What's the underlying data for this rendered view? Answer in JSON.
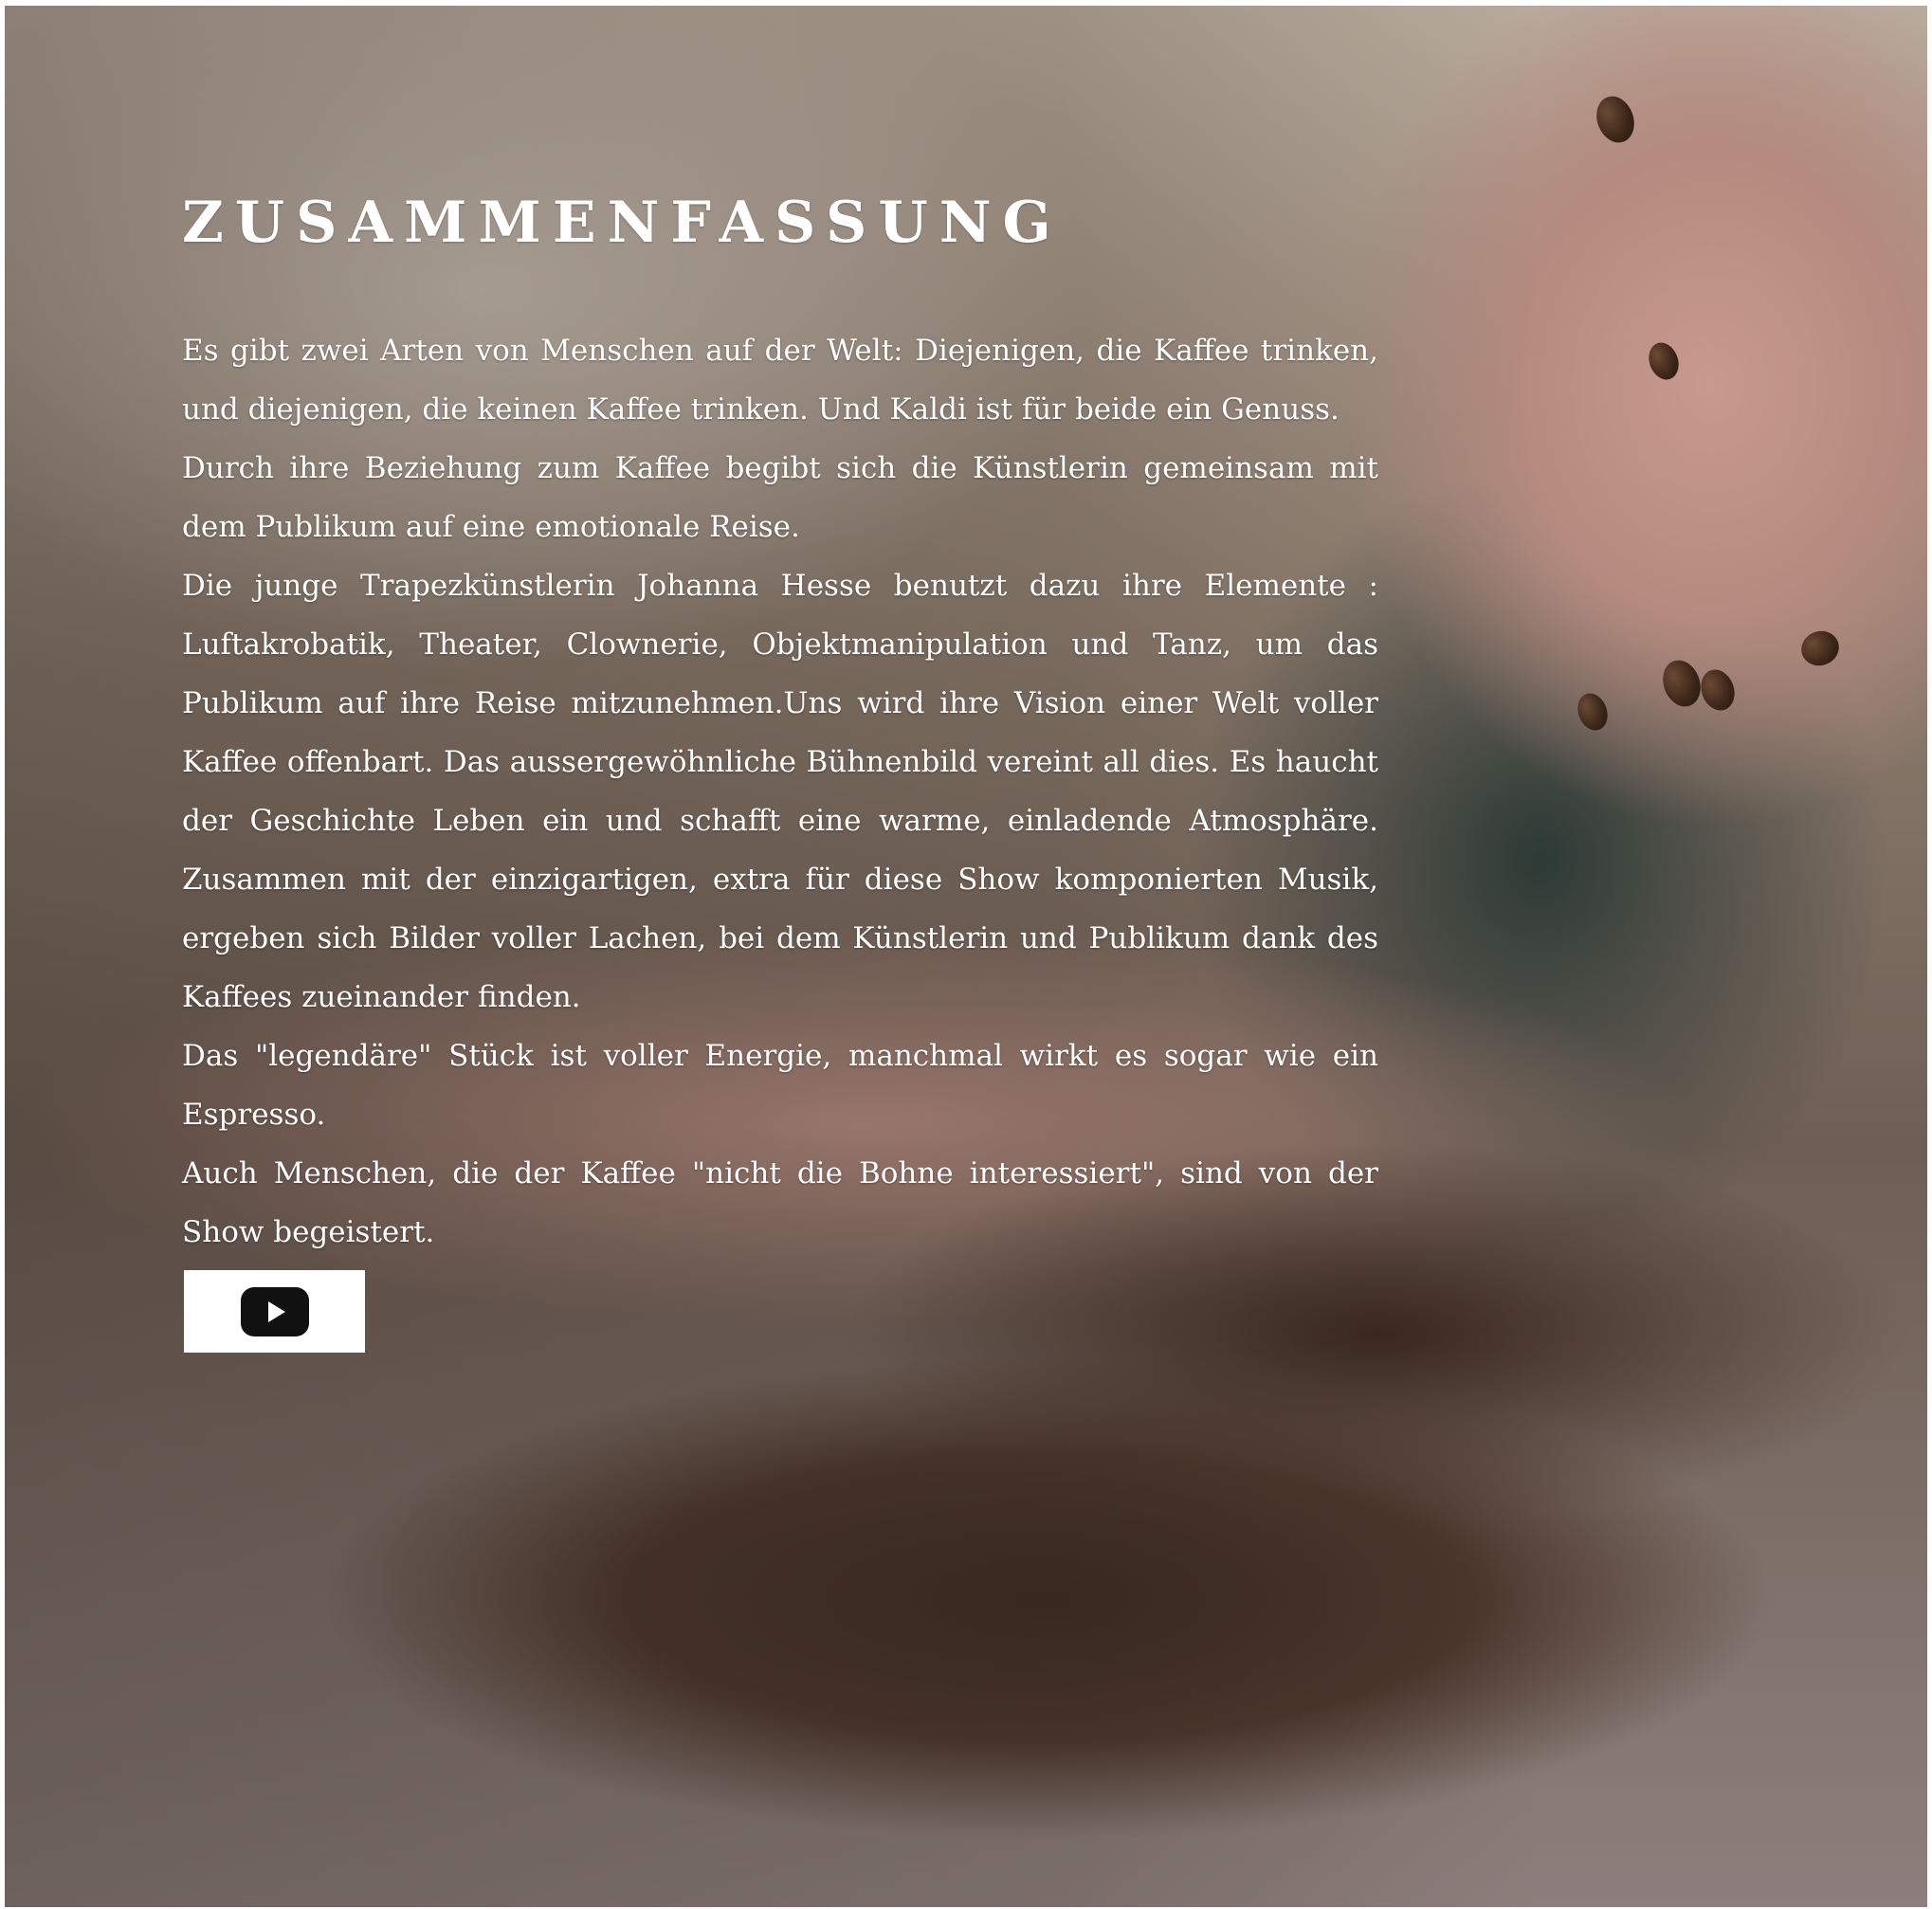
{
  "section": {
    "title": "ZUSAMMENFASSUNG",
    "paragraphs": [
      "Es gibt zwei Arten von Menschen auf der Welt: Diejenigen, die Kaffee trinken, und diejenigen, die keinen Kaffee trinken. Und Kaldi ist für beide ein Genuss.",
      "Durch ihre Beziehung zum Kaffee begibt sich die Künstlerin gemeinsam mit dem Publikum auf eine emotionale Reise.",
      "Die junge Trapezkünstlerin Johanna Hesse benutzt dazu ihre Elemente : Luftakrobatik, Theater, Clownerie, Objektmanipulation und Tanz, um das Publikum auf ihre Reise mitzunehmen.Uns wird ihre Vision einer Welt voller Kaffee offenbart. Das aussergewöhnliche Bühnenbild vereint all dies. Es haucht der Geschichte Leben ein und schafft eine warme, einladende Atmosphäre. Zusammen mit der einzigartigen, extra für diese Show komponierten Musik, ergeben sich Bilder voller Lachen, bei dem Künstlerin und Publikum dank des Kaffees zueinander finden.",
      "Das \"legendäre\" Stück ist voller Energie, manchmal wirkt es sogar wie ein Espresso.",
      "Auch Menschen, die der Kaffee \"nicht die Bohne interessiert\", sind von der Show begeistert."
    ]
  },
  "video_button": {
    "icon": "youtube-play-icon"
  },
  "colors": {
    "text": "#ffffff",
    "button_bg": "#ffffff",
    "icon": "#111111"
  }
}
